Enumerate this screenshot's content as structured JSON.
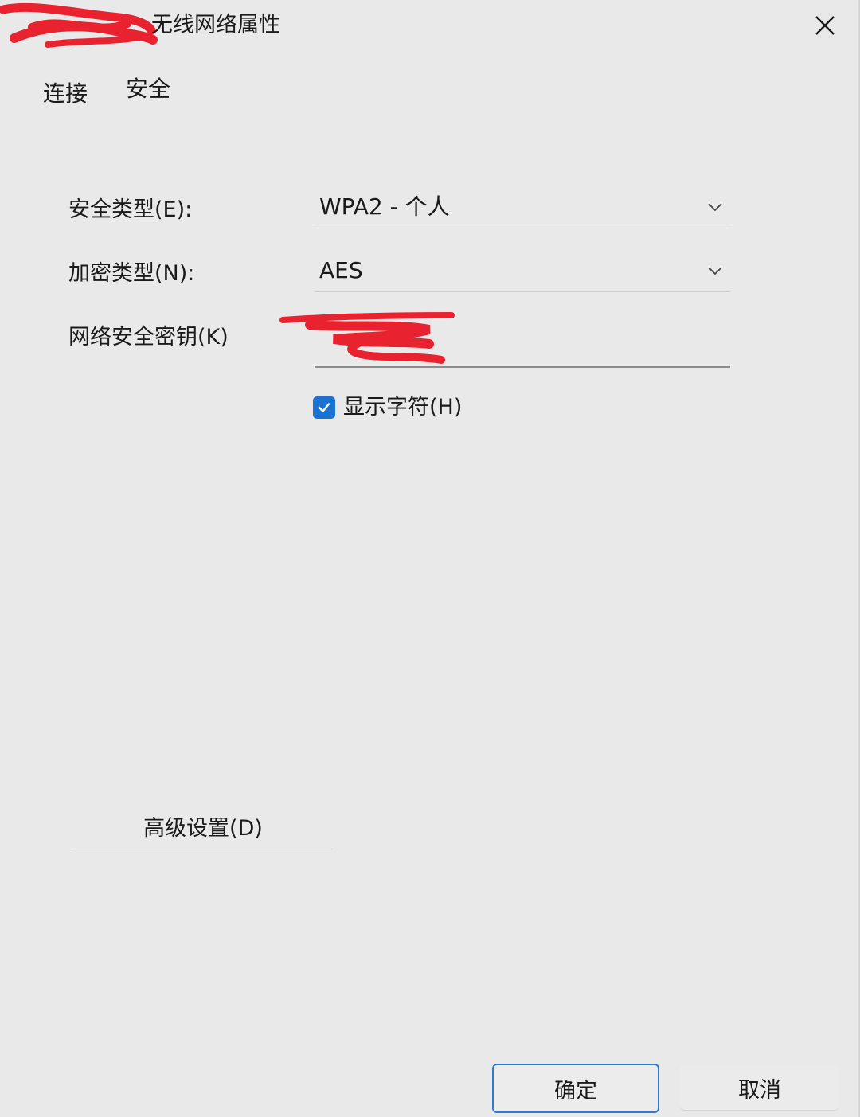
{
  "window": {
    "title": "无线网络属性",
    "close_icon": "close-icon"
  },
  "tabs": [
    {
      "label": "连接"
    },
    {
      "label": "安全"
    }
  ],
  "security": {
    "security_type_label": "安全类型(E):",
    "security_type_value": "WPA2 - 个人",
    "encryption_type_label": "加密类型(N):",
    "encryption_type_value": "AES",
    "network_key_label": "网络安全密钥(K)",
    "network_key_value": "",
    "show_characters_label": "显示字符(H)",
    "show_characters_checked": true
  },
  "buttons": {
    "advanced": "高级设置(D)",
    "ok": "确定",
    "cancel": "取消"
  },
  "colors": {
    "background": "#e9e9e9",
    "accent": "#1a73d0",
    "redaction": "#e8232f"
  }
}
